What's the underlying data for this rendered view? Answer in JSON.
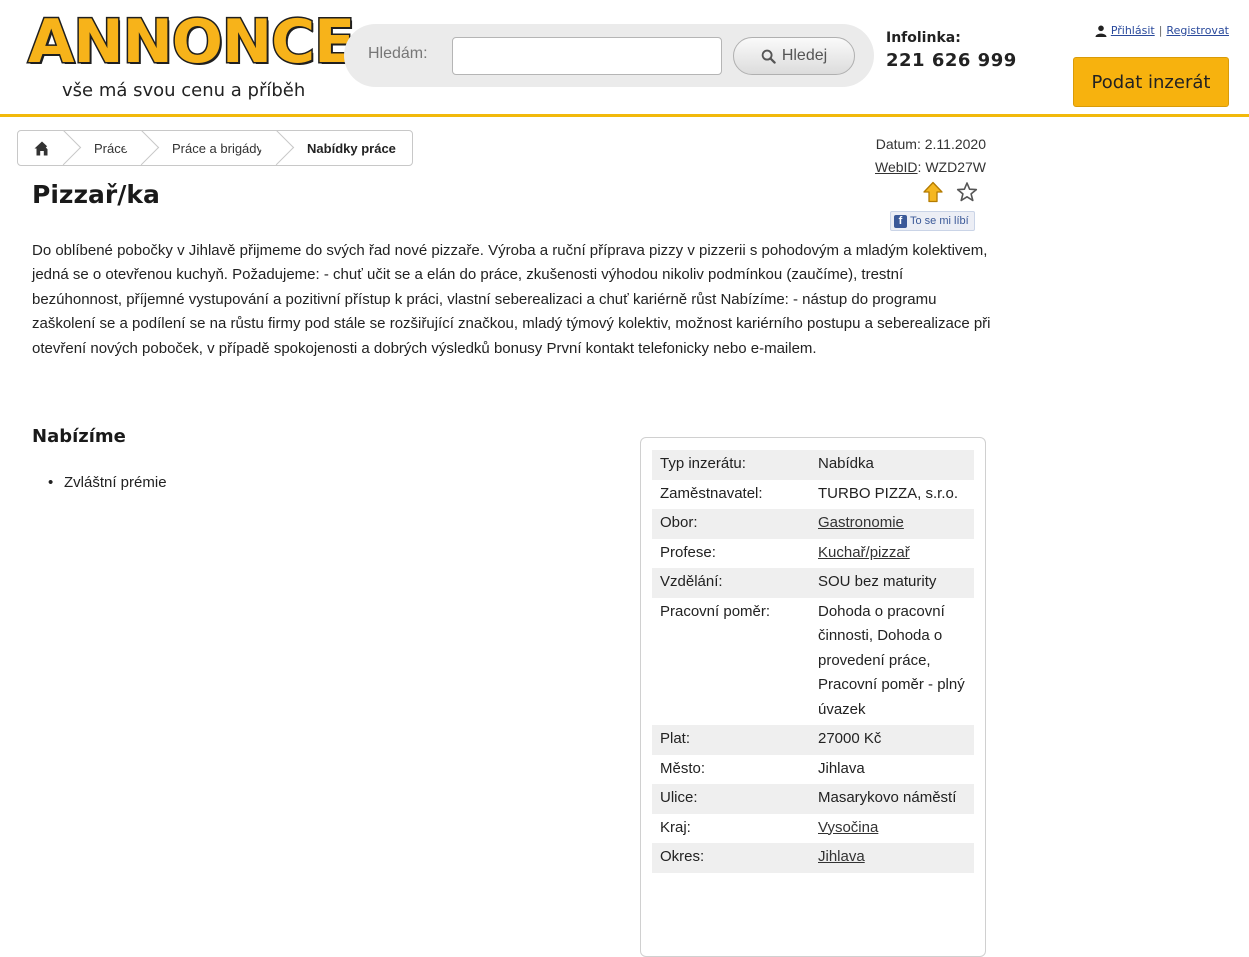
{
  "header": {
    "logo_word": "ANNONCE",
    "logo_tagline": "vše má svou cenu a příběh",
    "search_label": "Hledám:",
    "search_value": "",
    "search_button": "Hledej",
    "infoline_label": "Infolinka:",
    "infoline_number": "221 626 999",
    "login_link": "Přihlásit",
    "separator": "|",
    "register_link": "Registrovat",
    "post_ad_button": "Podat inzerát"
  },
  "breadcrumb": [
    {
      "label": "Práce"
    },
    {
      "label": "Práce a brigády"
    },
    {
      "label": "Nabídky práce"
    }
  ],
  "meta": {
    "date_text": "Datum: 2.11.2020",
    "webid_label": "WebID",
    "webid_value": ": WZD27W",
    "fb_like": "To se mi líbí"
  },
  "ad": {
    "title": "Pizzař/ka",
    "description": "Do oblíbené pobočky v Jihlavě přijmeme do svých řad nové pizzaře. Výroba a ruční příprava pizzy v pizzerii s pohodovým a mladým kolektivem, jedná se o otevřenou kuchyň. Požadujeme: - chuť učit se a elán do práce, zkušenosti výhodou nikoliv podmínkou (zaučíme), trestní bezúhonnost, příjemné vystupování a pozitivní přístup k práci, vlastní seberealizaci a chuť kariérně růst Nabízíme: - nástup do programu zaškolení se a podílení se na růstu firmy pod stále se rozšiřující značkou, mladý týmový kolektiv, možnost kariérního postupu a seberealizace při otevření nových poboček, v případě spokojenosti a dobrých výsledků bonusy První kontakt telefonicky nebo e-mailem.",
    "offer_section_title": "Nabízíme",
    "offer_items": [
      "Zvláštní prémie"
    ]
  },
  "details": [
    {
      "key": "Typ inzerátu:",
      "value": "Nabídka",
      "link": false
    },
    {
      "key": "Zaměstnavatel:",
      "value": "TURBO PIZZA, s.r.o.",
      "link": false
    },
    {
      "key": "Obor:",
      "value": "Gastronomie",
      "link": true
    },
    {
      "key": "Profese:",
      "value": "Kuchař/pizzař",
      "link": true
    },
    {
      "key": "Vzdělání:",
      "value": "SOU bez maturity",
      "link": false
    },
    {
      "key": "Pracovní poměr:",
      "value": "Dohoda o pracovní činnosti, Dohoda o provedení práce, Pracovní poměr - plný úvazek",
      "link": false
    },
    {
      "key": "Plat:",
      "value": "27000 Kč",
      "link": false
    },
    {
      "key": "Město:",
      "value": "Jihlava",
      "link": false
    },
    {
      "key": "Ulice:",
      "value": "Masarykovo náměstí",
      "link": false
    },
    {
      "key": "Kraj:",
      "value": "Vysočina",
      "link": true
    },
    {
      "key": "Okres:",
      "value": "Jihlava",
      "link": true
    }
  ],
  "icons": {
    "home": "home-icon",
    "search": "search-icon",
    "user": "user-icon",
    "top": "arrow-up-icon",
    "favorite": "star-icon"
  },
  "colors": {
    "brand_yellow": "#f7b20e",
    "header_border": "#f2b90b",
    "link_blue": "#2a4a9c",
    "facebook_blue": "#3b5998"
  }
}
